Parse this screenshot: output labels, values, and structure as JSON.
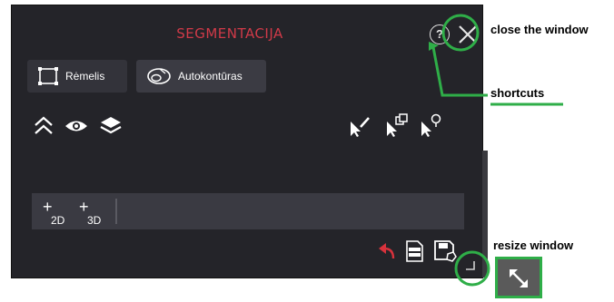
{
  "window": {
    "title": "SEGMENTACIJA",
    "help_symbol": "?"
  },
  "tabs": [
    {
      "label": "Rėmelis",
      "icon": "frame-icon"
    },
    {
      "label": "Autokontūras",
      "icon": "auto-contour-icon"
    }
  ],
  "toolbar_left": [
    "chevrons-up-icon",
    "eye-icon",
    "layers-icon"
  ],
  "toolbar_right": [
    "pointer-pen-icon",
    "pointer-copy-icon",
    "pointer-pin-icon"
  ],
  "dimensions": [
    {
      "plus": "+",
      "label": "2D"
    },
    {
      "plus": "+",
      "label": "3D"
    }
  ],
  "bottom_actions": [
    "undo-icon",
    "csv-export-icon",
    "save-icon"
  ],
  "annotations": {
    "close": "close the window",
    "shortcuts": "shortcuts",
    "resize": "resize window"
  },
  "colors": {
    "accent_title": "#d03a48",
    "annotation_green": "#2fae48",
    "panel_bg": "#242429"
  }
}
